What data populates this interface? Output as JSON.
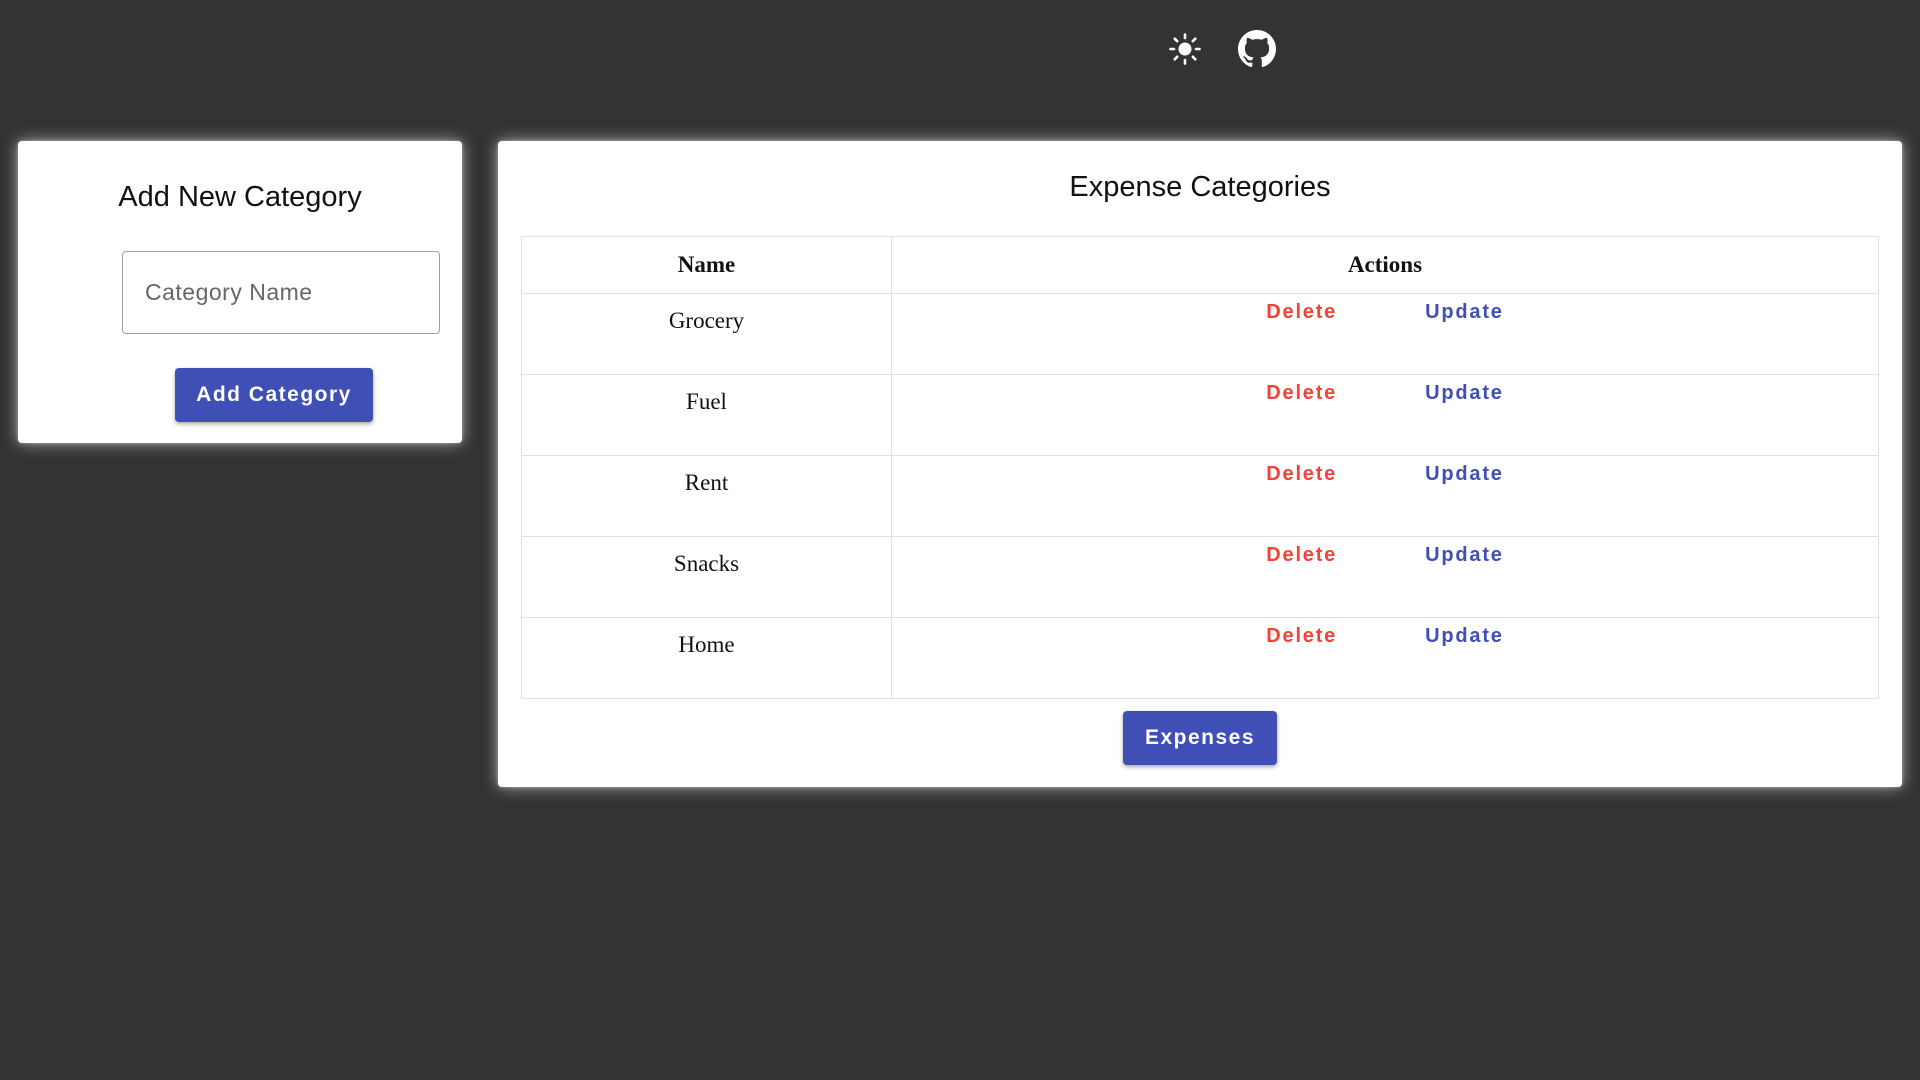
{
  "header": {
    "theme_toggle_icon": "sun-icon",
    "github_icon": "github-icon"
  },
  "add_category": {
    "title": "Add New Category",
    "input": {
      "placeholder": "Category Name",
      "value": ""
    },
    "button_label": "Add Category"
  },
  "categories": {
    "title": "Expense Categories",
    "columns": [
      "Name",
      "Actions"
    ],
    "rows": [
      {
        "name": "Grocery",
        "delete_label": "Delete",
        "update_label": "Update"
      },
      {
        "name": "Fuel",
        "delete_label": "Delete",
        "update_label": "Update"
      },
      {
        "name": "Rent",
        "delete_label": "Delete",
        "update_label": "Update"
      },
      {
        "name": "Snacks",
        "delete_label": "Delete",
        "update_label": "Update"
      },
      {
        "name": "Home",
        "delete_label": "Delete",
        "update_label": "Update"
      }
    ],
    "expenses_button_label": "Expenses"
  },
  "colors": {
    "background": "#333333",
    "primary": "#3f4fb5",
    "danger": "#f44336",
    "card": "#ffffff"
  }
}
